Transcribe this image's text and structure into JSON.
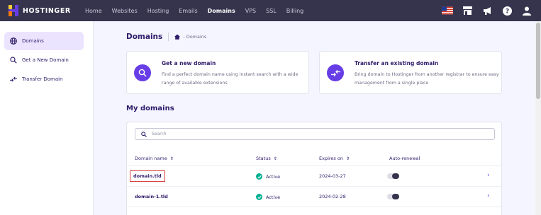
{
  "brand": {
    "name": "HOSTINGER"
  },
  "nav": {
    "items": [
      "Home",
      "Websites",
      "Hosting",
      "Emails",
      "Domains",
      "VPS",
      "SSL",
      "Billing"
    ],
    "active_index": 4
  },
  "topbar_icons": [
    "us-flag-icon",
    "store-icon",
    "megaphone-icon",
    "help-icon",
    "user-icon"
  ],
  "sidebar": {
    "items": [
      {
        "label": "Domains",
        "icon": "globe-icon",
        "active": true
      },
      {
        "label": "Get a New Domain",
        "icon": "search-icon",
        "active": false
      },
      {
        "label": "Transfer Domain",
        "icon": "transfer-icon",
        "active": false
      }
    ]
  },
  "page": {
    "title": "Domains",
    "breadcrumb": "- Domains"
  },
  "cards": [
    {
      "title": "Get a new domain",
      "desc_line1": "Find a perfect domain name using instant search with a wide",
      "desc_line2": "range of available extensions",
      "icon": "search-icon"
    },
    {
      "title": "Transfer an existing domain",
      "desc_line1": "Bring domain to Hostinger from another registrar to ensure easy",
      "desc_line2": "management from a single place",
      "icon": "transfer-icon"
    }
  ],
  "my_domains": {
    "title": "My domains",
    "search_placeholder": "Search",
    "columns": {
      "name": "Domain name",
      "status": "Status",
      "expires": "Expires on",
      "renewal": "Auto-renewal"
    },
    "sort_glyph": "⇕",
    "rows": [
      {
        "name": "domain.tld",
        "status": "Active",
        "expires": "2024-03-27",
        "auto_renewal": false,
        "highlighted": true
      },
      {
        "name": "domain-1.tld",
        "status": "Active",
        "expires": "2024-02-28",
        "auto_renewal": false,
        "highlighted": false
      }
    ]
  },
  "colors": {
    "topbar": "#36344d",
    "accent": "#673de6",
    "active_bg": "#ebe4ff",
    "success": "#00b090",
    "highlight_border": "#d63b3b"
  }
}
